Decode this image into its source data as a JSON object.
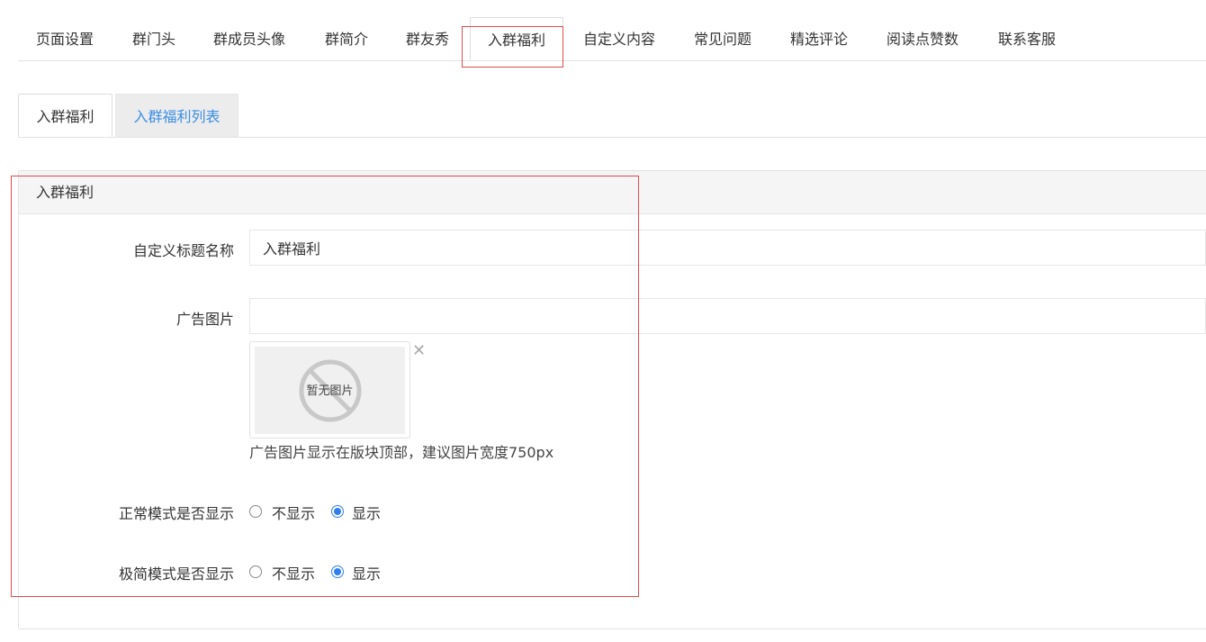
{
  "top_tabs": [
    {
      "label": "页面设置"
    },
    {
      "label": "群门头"
    },
    {
      "label": "群成员头像"
    },
    {
      "label": "群简介"
    },
    {
      "label": "群友秀"
    },
    {
      "label": "入群福利"
    },
    {
      "label": "自定义内容"
    },
    {
      "label": "常见问题"
    },
    {
      "label": "精选评论"
    },
    {
      "label": "阅读点赞数"
    },
    {
      "label": "联系客服"
    }
  ],
  "active_top_tab": "入群福利",
  "sub_tabs": [
    {
      "label": "入群福利"
    },
    {
      "label": "入群福利列表"
    }
  ],
  "panel": {
    "title": "入群福利",
    "title_field": {
      "label": "自定义标题名称",
      "value": "入群福利"
    },
    "ad_image": {
      "label": "广告图片",
      "value": "",
      "placeholder_text": "暂无图片",
      "remove_glyph": "✕",
      "hint": "广告图片显示在版块顶部，建议图片宽度750px"
    },
    "normal_mode": {
      "label": "正常模式是否显示",
      "options": [
        "不显示",
        "显示"
      ],
      "selected": "显示"
    },
    "simple_mode": {
      "label": "极简模式是否显示",
      "options": [
        "不显示",
        "显示"
      ],
      "selected": "显示"
    }
  },
  "colors": {
    "accent": "#2f7ff0",
    "link": "#3a8ee6",
    "highlight": "#e34a4a"
  }
}
